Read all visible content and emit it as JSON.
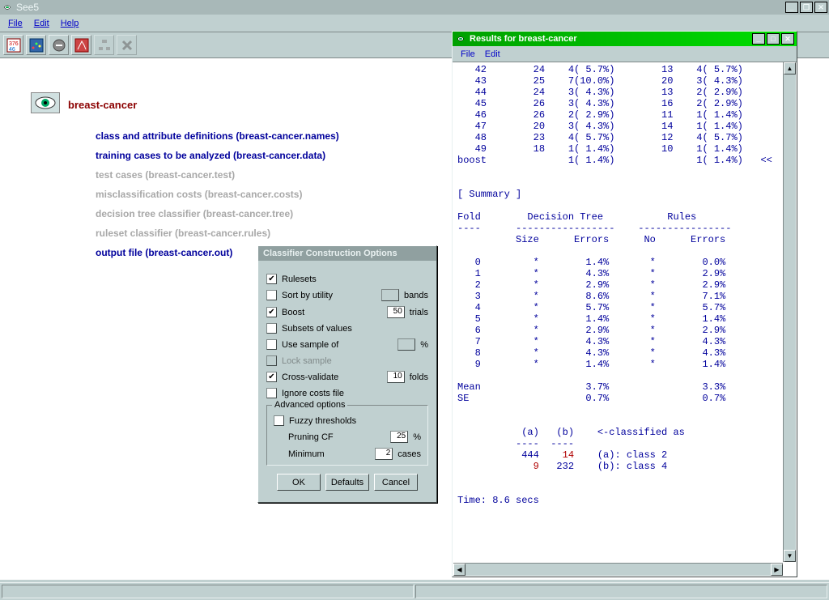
{
  "app": {
    "title": "See5",
    "menus": [
      "File",
      "Edit",
      "Help"
    ]
  },
  "dataset": {
    "name": "breast-cancer",
    "files": [
      {
        "label": "class and attribute definitions  (breast-cancer.names)",
        "active": true
      },
      {
        "label": "training cases to be analyzed  (breast-cancer.data)",
        "active": true
      },
      {
        "label": "test cases  (breast-cancer.test)",
        "active": false
      },
      {
        "label": "misclassification costs  (breast-cancer.costs)",
        "active": false
      },
      {
        "label": "decision tree classifier  (breast-cancer.tree)",
        "active": false
      },
      {
        "label": "ruleset classifier  (breast-cancer.rules)",
        "active": false
      },
      {
        "label": "output file  (breast-cancer.out)",
        "active": true
      }
    ]
  },
  "dialog": {
    "title": "Classifier Construction Options",
    "rulesets": {
      "label": "Rulesets",
      "checked": true
    },
    "sortutil": {
      "label": "Sort by utility",
      "checked": false,
      "bands_label": "bands",
      "bands": ""
    },
    "boost": {
      "label": "Boost",
      "checked": true,
      "trials": "50",
      "trials_label": "trials"
    },
    "subsets": {
      "label": "Subsets of values",
      "checked": false
    },
    "sample": {
      "label": "Use sample of",
      "checked": false,
      "pct_label": "%"
    },
    "lock": {
      "label": "Lock sample",
      "checked": false
    },
    "cv": {
      "label": "Cross-validate",
      "checked": true,
      "folds": "10",
      "folds_label": "folds"
    },
    "ignorecosts": {
      "label": "Ignore costs file",
      "checked": false
    },
    "adv_title": "Advanced options",
    "fuzzy": {
      "label": "Fuzzy thresholds",
      "checked": false
    },
    "pruning": {
      "label": "Pruning CF",
      "value": "25",
      "unit": "%"
    },
    "minimum": {
      "label": "Minimum",
      "value": "2",
      "unit": "cases"
    },
    "buttons": {
      "ok": "OK",
      "defaults": "Defaults",
      "cancel": "Cancel"
    }
  },
  "results": {
    "title": "Results for breast-cancer",
    "menus": [
      "File",
      "Edit"
    ],
    "top_rows": [
      {
        "n": "42",
        "a": "24",
        "b": "4( 5.7%)",
        "c": "13",
        "d": "4( 5.7%)"
      },
      {
        "n": "43",
        "a": "25",
        "b": "7(10.0%)",
        "c": "20",
        "d": "3( 4.3%)"
      },
      {
        "n": "44",
        "a": "24",
        "b": "3( 4.3%)",
        "c": "13",
        "d": "2( 2.9%)"
      },
      {
        "n": "45",
        "a": "26",
        "b": "3( 4.3%)",
        "c": "16",
        "d": "2( 2.9%)"
      },
      {
        "n": "46",
        "a": "26",
        "b": "2( 2.9%)",
        "c": "11",
        "d": "1( 1.4%)"
      },
      {
        "n": "47",
        "a": "20",
        "b": "3( 4.3%)",
        "c": "14",
        "d": "1( 1.4%)"
      },
      {
        "n": "48",
        "a": "23",
        "b": "4( 5.7%)",
        "c": "12",
        "d": "4( 5.7%)"
      },
      {
        "n": "49",
        "a": "18",
        "b": "1( 1.4%)",
        "c": "10",
        "d": "1( 1.4%)"
      }
    ],
    "boost_row": {
      "n": "boost",
      "b": "1( 1.4%)",
      "d": "1( 1.4%)",
      "mark": "<<"
    },
    "summary_label": "[ Summary ]",
    "summary_header": {
      "fold": "Fold",
      "dt": "Decision Tree",
      "rules": "Rules",
      "size": "Size",
      "errors": "Errors",
      "no": "No"
    },
    "summary_rows": [
      {
        "fold": "0",
        "size": "*",
        "dte": "1.4%",
        "no": "*",
        "re": "0.0%"
      },
      {
        "fold": "1",
        "size": "*",
        "dte": "4.3%",
        "no": "*",
        "re": "2.9%"
      },
      {
        "fold": "2",
        "size": "*",
        "dte": "2.9%",
        "no": "*",
        "re": "2.9%"
      },
      {
        "fold": "3",
        "size": "*",
        "dte": "8.6%",
        "no": "*",
        "re": "7.1%"
      },
      {
        "fold": "4",
        "size": "*",
        "dte": "5.7%",
        "no": "*",
        "re": "5.7%"
      },
      {
        "fold": "5",
        "size": "*",
        "dte": "1.4%",
        "no": "*",
        "re": "1.4%"
      },
      {
        "fold": "6",
        "size": "*",
        "dte": "2.9%",
        "no": "*",
        "re": "2.9%"
      },
      {
        "fold": "7",
        "size": "*",
        "dte": "4.3%",
        "no": "*",
        "re": "4.3%"
      },
      {
        "fold": "8",
        "size": "*",
        "dte": "4.3%",
        "no": "*",
        "re": "4.3%"
      },
      {
        "fold": "9",
        "size": "*",
        "dte": "1.4%",
        "no": "*",
        "re": "1.4%"
      }
    ],
    "mean": {
      "label": "Mean",
      "dte": "3.7%",
      "re": "3.3%"
    },
    "se": {
      "label": "SE",
      "dte": "0.7%",
      "re": "0.7%"
    },
    "confusion": {
      "header_a": "(a)",
      "header_b": "(b)",
      "class_as": "<-classified as",
      "row1_a": "444",
      "row1_b": "14",
      "row1_l": "(a): class 2",
      "row2_a": "9",
      "row2_b": "232",
      "row2_l": "(b): class 4"
    },
    "time": "Time: 8.6 secs"
  }
}
